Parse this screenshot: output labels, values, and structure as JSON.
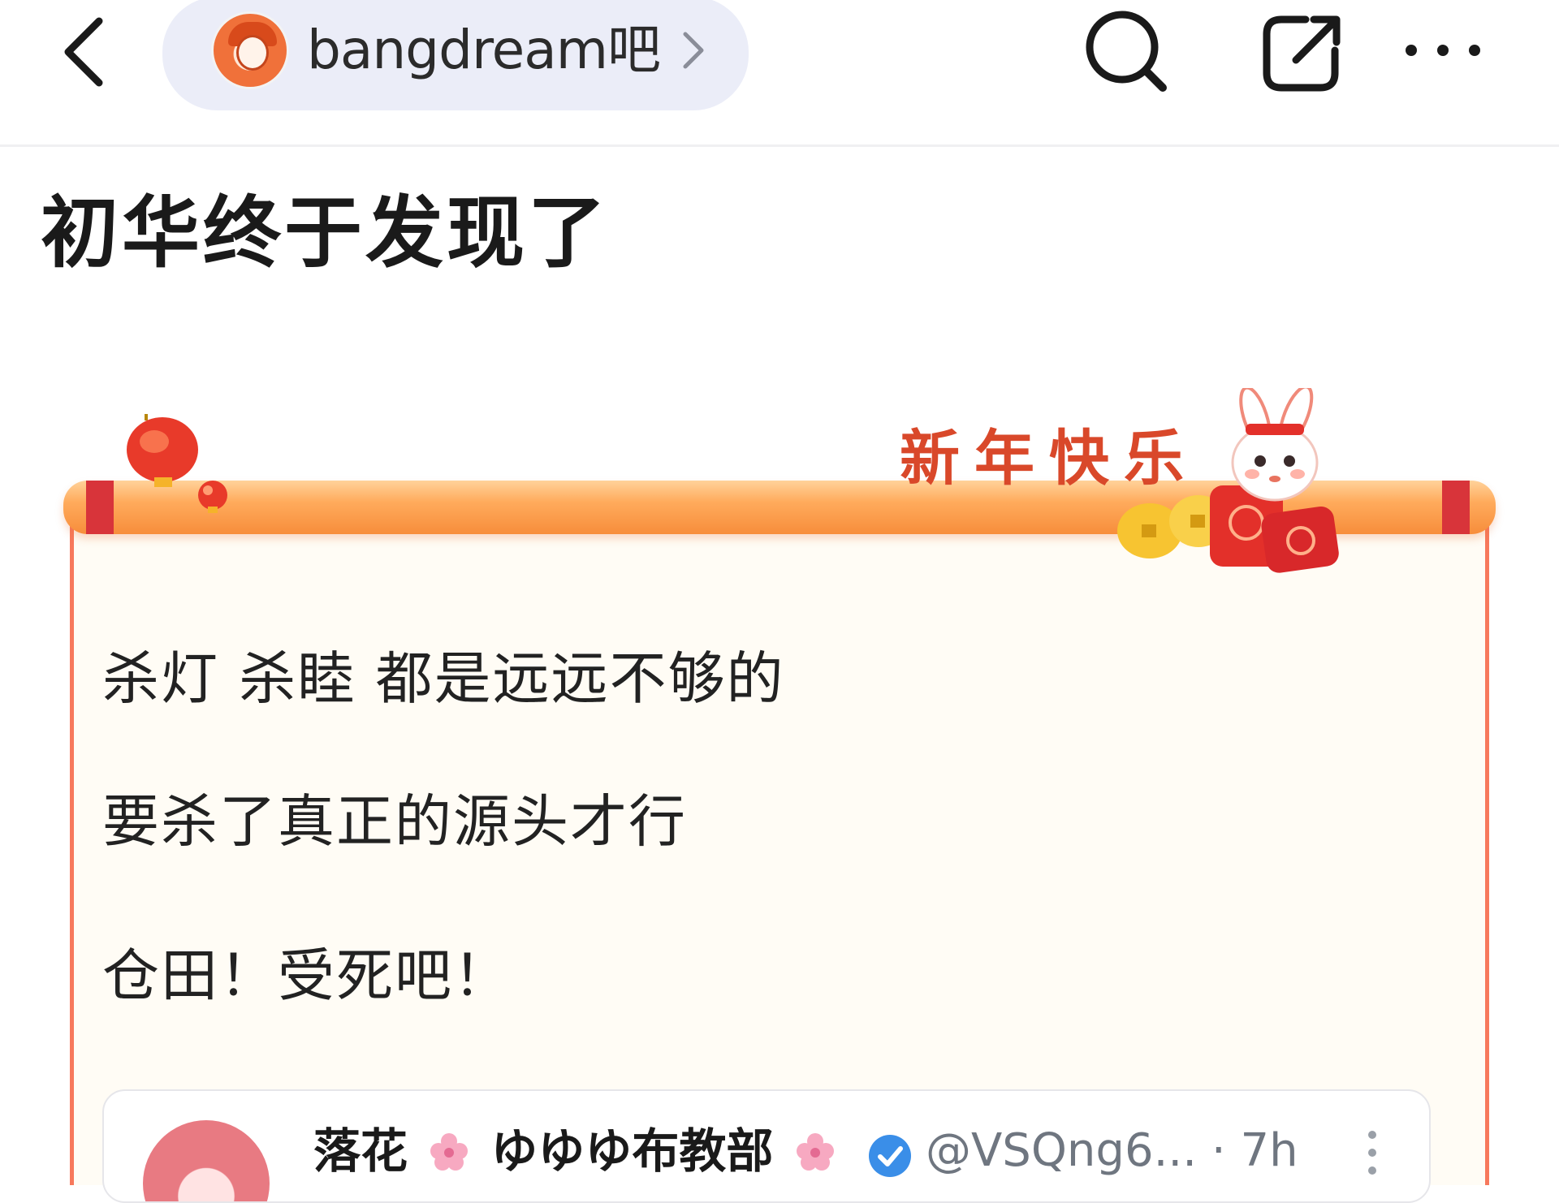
{
  "nav": {
    "forum_name": "bangdream吧"
  },
  "post": {
    "title": "初华终于发现了",
    "greeting": "新年快乐",
    "lines": [
      "杀灯 杀睦 都是远远不够的",
      "要杀了真正的源头才行",
      "仓田！受死吧！"
    ]
  },
  "quote": {
    "name_part1": "落花",
    "name_part2": "ゆゆゆ布教部",
    "handle": "@VSQng6...",
    "separator": "·",
    "time": "7h"
  },
  "colors": {
    "pill_bg": "#ebedf8",
    "card_bg": "#fffcf5",
    "card_border": "#f7795c",
    "greeting": "#d9482a",
    "verified": "#3a8ee8"
  },
  "icons": [
    "back-arrow-icon",
    "chevron-right-icon",
    "search-icon",
    "share-icon",
    "more-icon",
    "lantern-icon",
    "bunny-icon",
    "flower-icon",
    "verified-icon"
  ]
}
